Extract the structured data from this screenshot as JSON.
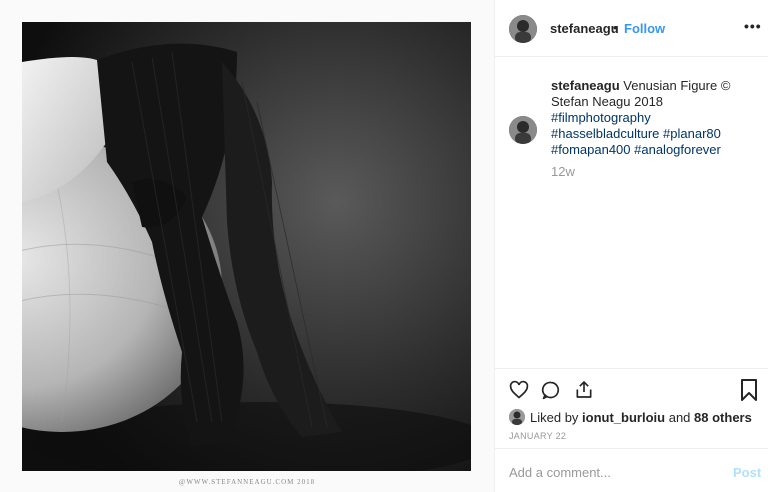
{
  "post": {
    "username": "stefaneagu",
    "separator": "•",
    "follow_label": "Follow",
    "more_label": "•••",
    "photo_credit": "@WWW.STEFANNEAGU.COM 2018"
  },
  "caption": {
    "username": "stefaneagu",
    "text": "Venusian Figure © Stefan Neagu 2018",
    "hashtags": [
      "#filmphotography",
      "#hasselbladculture",
      "#planar80",
      "#fomapan400",
      "#analogforever"
    ],
    "time_ago": "12w"
  },
  "likes": {
    "prefix": "Liked by",
    "user": "ionut_burloiu",
    "and_label": "and",
    "others": "88 others"
  },
  "date": "JANUARY 22",
  "comment_box": {
    "placeholder": "Add a comment...",
    "post_label": "Post"
  },
  "colors": {
    "link_blue": "#3897f0",
    "hashtag": "#003569",
    "post_disabled": "#b2dffc"
  },
  "icons": [
    "heart-icon",
    "comment-icon",
    "share-icon",
    "bookmark-icon",
    "more-options-icon"
  ]
}
